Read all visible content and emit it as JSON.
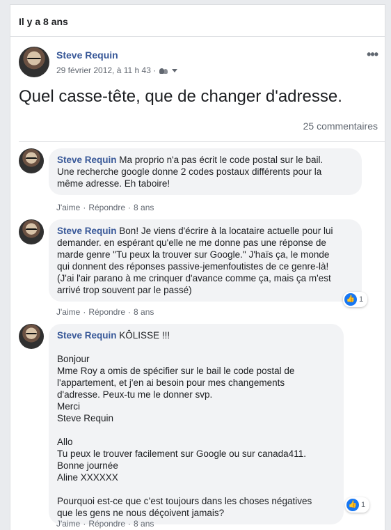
{
  "memory": {
    "title": "Il y a 8 ans"
  },
  "post": {
    "author": "Steve Requin",
    "timestamp": "29 février 2012, à 11 h 43 ·",
    "text": "Quel casse-tête, que de changer d'adresse.",
    "comment_count": "25 commentaires",
    "more": "•••"
  },
  "actions": {
    "like": "J'aime",
    "reply": "Répondre",
    "age": "8 ans",
    "sep": "·"
  },
  "comments": [
    {
      "author": "Steve Requin",
      "lines": [
        "Ma proprio n'a pas écrit le code postal sur le bail.",
        "Une recherche google donne 2 codes postaux différents pour la",
        "même adresse. Eh taboire!"
      ]
    },
    {
      "author": "Steve Requin",
      "lines": [
        "Bon! Je viens d'écrire à la locataire actuelle pour lui",
        "demander. en espérant qu'elle ne me donne pas une réponse de",
        "marde genre \"Tu peux la trouver sur Google.\" J'haïs ça, le monde",
        "qui donnent des réponses passive-jemenfoutistes de ce genre-là!",
        "(J'ai l'air parano à me crinquer d'avance comme ça, mais ça m'est",
        "arrivé trop souvent par le passé)"
      ],
      "reactions": "1"
    },
    {
      "author": "Steve Requin",
      "lines": [
        "KÔLISSE !!!",
        "",
        "Bonjour",
        "Mme Roy a omis de spécifier sur le bail le code postal de",
        "l'appartement, et j'en ai besoin pour mes changements",
        "d'adresse. Peux-tu me le donner svp.",
        "Merci",
        "Steve Requin",
        "",
        "Allo",
        "Tu peux le trouver facilement sur Google ou sur canada411.",
        "Bonne journée",
        "Aline XXXXXX",
        "",
        "Pourquoi est-ce que c’est toujours dans les choses négatives",
        "que les gens ne nous déçoivent jamais?"
      ],
      "reactions": "1"
    }
  ],
  "colors": {
    "link": "#385898",
    "meta": "#616770",
    "bubble": "#f2f3f5",
    "like": "#1877f2"
  }
}
